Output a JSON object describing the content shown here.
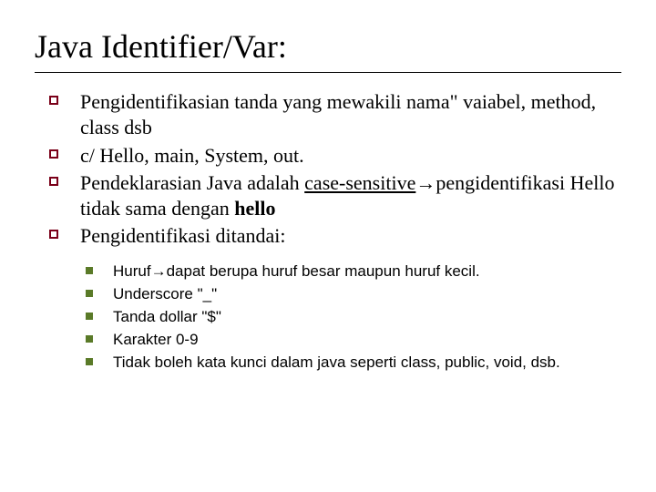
{
  "title": "Java Identifier/Var:",
  "bullets": [
    {
      "text": "Pengidentifikasian tanda yang mewakili nama\" vaiabel, method, class dsb"
    },
    {
      "text": "c/ Hello, main, System, out."
    },
    {
      "prefix": "Pendeklarasian Java adalah ",
      "underlined": "case-sensitive",
      "arrow": "→",
      "mid1": "pengidentifikasi Hello tidak sama dengan ",
      "bold": "hello"
    },
    {
      "text": "Pengidentifikasi ditandai:"
    }
  ],
  "sub_bullets": [
    {
      "prefix": "Huruf",
      "arrow": "→",
      "rest": "dapat berupa huruf besar maupun huruf kecil."
    },
    {
      "text": "Underscore \"_\""
    },
    {
      "text": "Tanda dollar \"$\""
    },
    {
      "text": "Karakter 0-9"
    },
    {
      "text": "Tidak boleh kata kunci dalam java seperti class, public, void, dsb."
    }
  ]
}
